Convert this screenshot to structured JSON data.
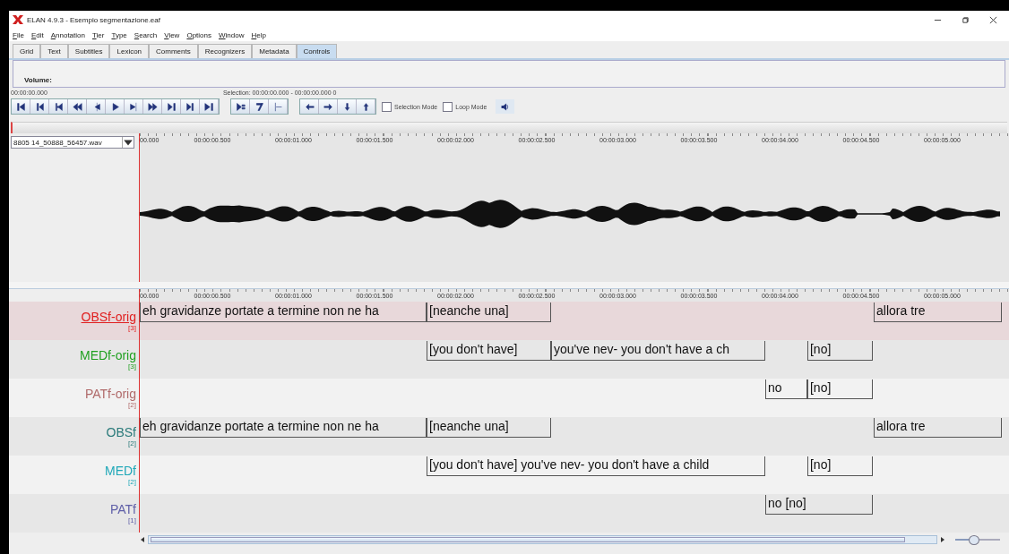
{
  "window": {
    "title": "ELAN 4.9.3 - Esempio segmentazione.eaf"
  },
  "menu": [
    "File",
    "Edit",
    "Annotation",
    "Tier",
    "Type",
    "Search",
    "View",
    "Options",
    "Window",
    "Help"
  ],
  "tabs": [
    {
      "label": "Grid",
      "selected": false
    },
    {
      "label": "Text",
      "selected": false
    },
    {
      "label": "Subtitles",
      "selected": false
    },
    {
      "label": "Lexicon",
      "selected": false
    },
    {
      "label": "Comments",
      "selected": false
    },
    {
      "label": "Recognizers",
      "selected": false
    },
    {
      "label": "Metadata",
      "selected": false
    },
    {
      "label": "Controls",
      "selected": true
    }
  ],
  "volume_label": "Volume:",
  "media_time": "00:00:00.000",
  "selection": "Selection: 00:00:00.000 - 00:00:00.000  0",
  "options": [
    {
      "label": "Selection Mode",
      "checked": false
    },
    {
      "label": "Loop Mode",
      "checked": false
    }
  ],
  "waveform": {
    "media_file": "8805 14_50888_56457.wav",
    "ruler": [
      "00.000",
      "00:00:00.500",
      "00:00:01.000",
      "00:00:01.500",
      "00:00:02.000",
      "00:00:02.500",
      "00:00:03.000",
      "00:00:03.500",
      "00:00:04.000",
      "00:00:04.500",
      "00:00:05.000"
    ]
  },
  "timeline": {
    "ruler": [
      "00.000",
      "00:00:00.500",
      "00:00:01.000",
      "00:00:01.500",
      "00:00:02.000",
      "00:00:02.500",
      "00:00:03.000",
      "00:00:03.500",
      "00:00:04.000",
      "00:00:04.500",
      "00:00:05.000"
    ],
    "tiers": [
      {
        "name": "OBSf-orig",
        "count": "[3]",
        "color": "#e02020",
        "active": true,
        "annotations": [
          "eh gravidanze portate a termine non ne ha",
          "[neanche una]",
          "allora tre"
        ]
      },
      {
        "name": "MEDf-orig",
        "count": "[3]",
        "color": "#20a020",
        "active": false,
        "annotations": [
          "[you don't have]",
          "you've nev- you don't have a ch",
          "[no]"
        ]
      },
      {
        "name": "PATf-orig",
        "count": "[2]",
        "color": "#b06a6a",
        "active": false,
        "annotations": [
          "no",
          "[no]"
        ]
      },
      {
        "name": "OBSf",
        "count": "[2]",
        "color": "#2a7a7a",
        "active": false,
        "annotations": [
          "eh gravidanze portate a termine non ne ha",
          "[neanche una]",
          "allora tre"
        ]
      },
      {
        "name": "MEDf",
        "count": "[2]",
        "color": "#20a8b8",
        "active": false,
        "annotations": [
          "[you don't have] you've nev- you don't have a child",
          "[no]"
        ]
      },
      {
        "name": "PATf",
        "count": "[1]",
        "color": "#6060a8",
        "active": false,
        "annotations": [
          "no [no]"
        ]
      }
    ]
  },
  "zoom": {
    "level": 0.4
  }
}
